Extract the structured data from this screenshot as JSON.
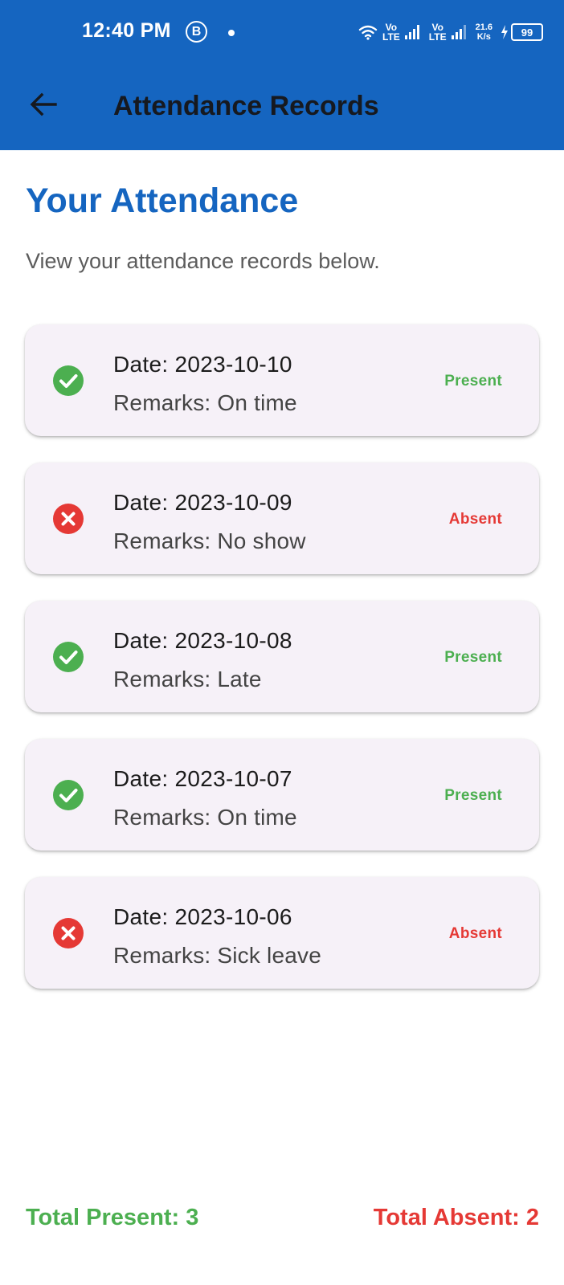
{
  "colors": {
    "app_bar": "#1565c0",
    "heading": "#1565c0",
    "present": "#4caf50",
    "absent": "#e53935",
    "card_bg": "#f6f1f8"
  },
  "status_bar": {
    "time": "12:40 PM",
    "notification_letter": "B",
    "sim1_label_top": "Vo",
    "sim1_label_bottom": "LTE",
    "sim2_label_top": "Vo",
    "sim2_label_bottom": "LTE",
    "speed_value": "21.6",
    "speed_unit": "K/s",
    "battery": "99",
    "icons": [
      "wifi-icon",
      "signal-icon",
      "signal-icon",
      "charging-icon",
      "battery-icon"
    ]
  },
  "app_bar": {
    "title": "Attendance Records",
    "back_icon": "arrow-left-icon"
  },
  "main": {
    "heading": "Your Attendance",
    "subheading": "View your attendance records below."
  },
  "records": [
    {
      "date": "Date: 2023-10-10",
      "remarks": "Remarks: On time",
      "status": "Present",
      "icon": "check-circle-icon"
    },
    {
      "date": "Date: 2023-10-09",
      "remarks": "Remarks: No show",
      "status": "Absent",
      "icon": "cancel-circle-icon"
    },
    {
      "date": "Date: 2023-10-08",
      "remarks": "Remarks: Late",
      "status": "Present",
      "icon": "check-circle-icon"
    },
    {
      "date": "Date: 2023-10-07",
      "remarks": "Remarks: On time",
      "status": "Present",
      "icon": "check-circle-icon"
    },
    {
      "date": "Date: 2023-10-06",
      "remarks": "Remarks: Sick leave",
      "status": "Absent",
      "icon": "cancel-circle-icon"
    }
  ],
  "totals": {
    "present": "Total Present: 3",
    "absent": "Total Absent: 2"
  }
}
